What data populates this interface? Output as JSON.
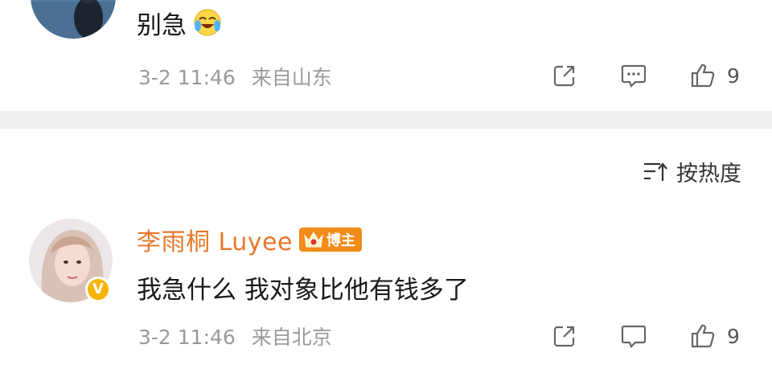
{
  "comments": [
    {
      "text": "别急",
      "emoji": "laughing-crying-emoji",
      "date": "3-2 11:46",
      "location": "来自山东",
      "likes": "9"
    },
    {
      "username": "李雨桐 Luyee",
      "role_badge": "博主",
      "verified_badge": "V",
      "text": "我急什么 我对象比他有钱多了",
      "date": "3-2 11:46",
      "location": "来自北京",
      "likes": "9"
    }
  ],
  "sort": {
    "label": "按热度"
  },
  "colors": {
    "username": "#e8782a",
    "badge": "#f28b18",
    "verified": "#f6b400",
    "meta": "#9a9a9a",
    "divider": "#efeff1"
  }
}
